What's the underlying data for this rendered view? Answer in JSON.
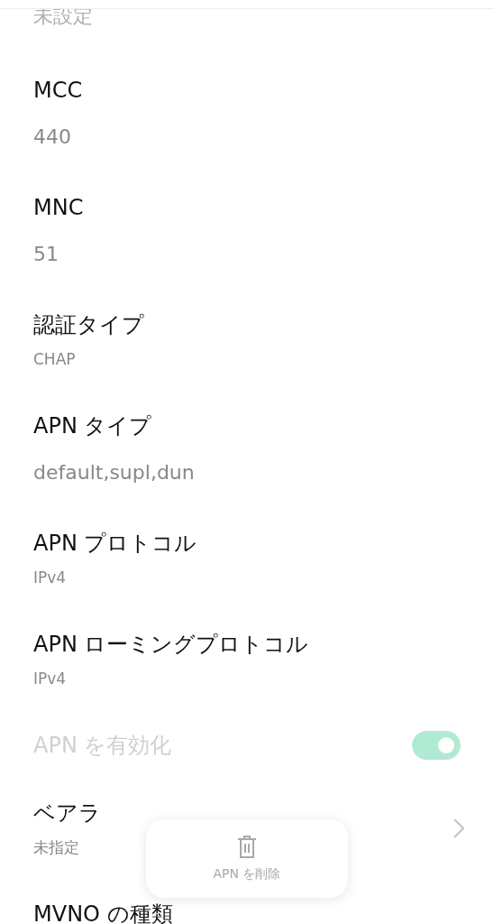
{
  "top_value": {
    "text": "未設定",
    "disabled": true
  },
  "rows": [
    {
      "kind": "text",
      "title": "MCC",
      "value": "440",
      "disabled": false
    },
    {
      "kind": "text",
      "title": "MNC",
      "value": "51",
      "disabled": false
    },
    {
      "kind": "list",
      "title": "認証タイプ",
      "value": "CHAP",
      "disabled": false
    },
    {
      "kind": "text",
      "title": "APN タイプ",
      "value": "default,supl,dun",
      "disabled": false
    },
    {
      "kind": "list",
      "title": "APN プロトコル",
      "value": "IPv4",
      "disabled": false
    },
    {
      "kind": "list",
      "title": "APN ローミングプロトコル",
      "value": "IPv4",
      "disabled": false
    },
    {
      "kind": "switch",
      "title": "APN を有効化",
      "on": true,
      "disabled": true
    },
    {
      "kind": "link",
      "title": "ベアラ",
      "value": "未指定",
      "disabled": false
    },
    {
      "kind": "title",
      "title": "MVNO の種類",
      "disabled": false
    }
  ],
  "floating_button": {
    "label": "APN を削除",
    "disabled": true
  }
}
